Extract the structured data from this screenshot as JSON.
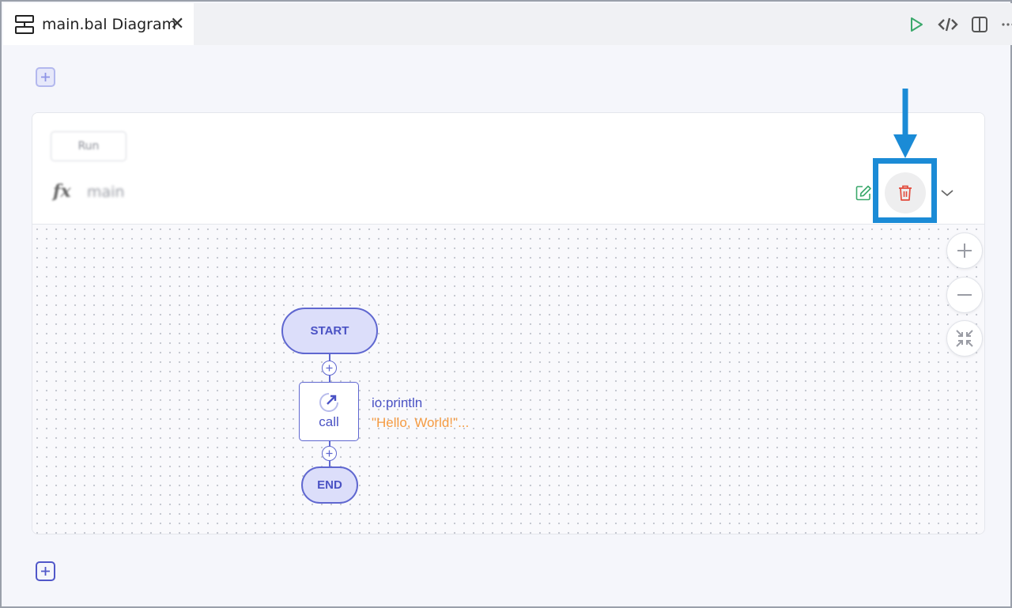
{
  "tab": {
    "title": "main.bal Diagram",
    "close": "✕",
    "icon": "diagram-icon"
  },
  "toolbar": {
    "icons": [
      "run-icon",
      "code-icon",
      "split-editor-icon",
      "more-icon"
    ]
  },
  "colors": {
    "accent": "#5f67d0",
    "delete": "#e24a3b",
    "edit": "#3aa86b",
    "highlight": "#1b8bd6",
    "argument": "#f59b42"
  },
  "function_card": {
    "run_label": "Run",
    "fx": "fx",
    "name": "main"
  },
  "diagram": {
    "start_label": "START",
    "end_label": "END",
    "call_label": "call",
    "call_function": "io:println",
    "call_argument": "\"Hello, World!\"..."
  },
  "annotation": {
    "target": "delete-function-button"
  }
}
